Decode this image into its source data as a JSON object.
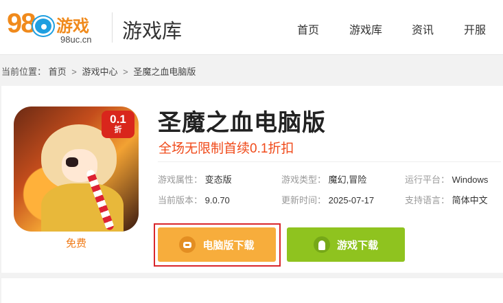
{
  "header": {
    "logo_number": "98",
    "logo_text": "游戏",
    "logo_domain": "98uc.cn",
    "site_title": "游戏库",
    "nav": [
      {
        "label": "首页"
      },
      {
        "label": "游戏库"
      },
      {
        "label": "资讯"
      },
      {
        "label": "开服"
      }
    ]
  },
  "breadcrumb": {
    "prefix": "当前位置：",
    "items": [
      {
        "label": "首页"
      },
      {
        "label": "游戏中心"
      },
      {
        "label": "圣魔之血电脑版"
      }
    ],
    "separator": ">"
  },
  "game": {
    "title": "圣魔之血电脑版",
    "subtitle": "全场无限制首续0.1折扣",
    "badge_value": "0.1",
    "badge_unit": "折",
    "price_label": "免费",
    "info": {
      "type_attr_key": "游戏属性：",
      "type_attr_val": "变态版",
      "genre_key": "游戏类型：",
      "genre_val": "魔幻,冒险",
      "platform_key": "运行平台：",
      "platform_val": "Windows",
      "version_key": "当前版本：",
      "version_val": "9.0.70",
      "updated_key": "更新时间：",
      "updated_val": "2025-07-17",
      "language_key": "支持语言：",
      "language_val": "简体中文"
    }
  },
  "buttons": {
    "pc_download": "电脑版下载",
    "game_download": "游戏下载"
  },
  "icons": {
    "pc_button_icon": "gamepad-icon",
    "game_button_icon": "android-icon"
  },
  "colors": {
    "brand_orange": "#f08a1c",
    "pc_button": "#f7ad3c",
    "game_button": "#8fc31f",
    "highlight_frame": "#d9262a",
    "subtitle": "#f04a1a"
  }
}
